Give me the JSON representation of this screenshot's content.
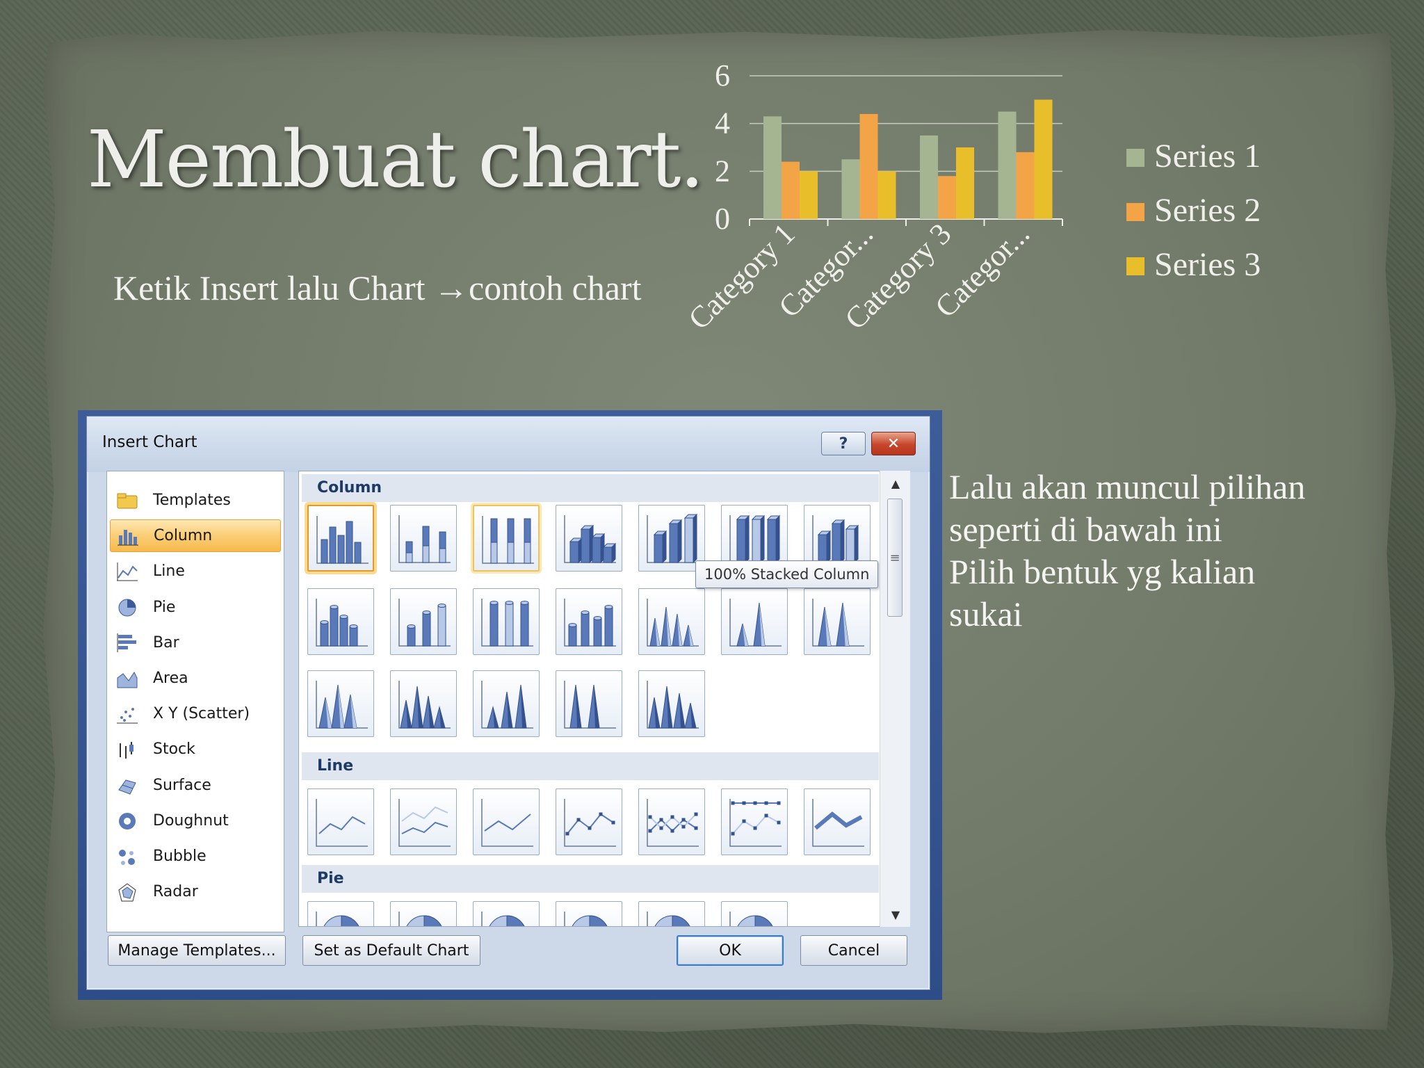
{
  "slide": {
    "title": "Membuat chart.",
    "subtitle": "Ketik Insert lalu Chart →contoh chart",
    "right_text": [
      "Lalu akan muncul pilihan",
      "seperti di bawah ini",
      "Pilih bentuk yg kalian",
      "sukai"
    ]
  },
  "chart_data": {
    "type": "bar",
    "categories": [
      "Category 1",
      "Categor...",
      "Category 3",
      "Categor..."
    ],
    "series": [
      {
        "name": "Series 1",
        "values": [
          4.3,
          2.5,
          3.5,
          4.5
        ],
        "color": "#a5b592"
      },
      {
        "name": "Series 2",
        "values": [
          2.4,
          4.4,
          1.8,
          2.8
        ],
        "color": "#f3a447"
      },
      {
        "name": "Series 3",
        "values": [
          2.0,
          2.0,
          3.0,
          5.0
        ],
        "color": "#e8bf2a"
      }
    ],
    "ylim": [
      0,
      6
    ],
    "yticks": [
      "0",
      "2",
      "4",
      "6"
    ],
    "grid": true,
    "legend": "right"
  },
  "dialog": {
    "title": "Insert Chart",
    "help_label": "?",
    "close_label": "✕",
    "chart_types": [
      {
        "label": "Templates",
        "icon": "folder-icon"
      },
      {
        "label": "Column",
        "icon": "column-chart-icon",
        "selected": true
      },
      {
        "label": "Line",
        "icon": "line-chart-icon"
      },
      {
        "label": "Pie",
        "icon": "pie-chart-icon"
      },
      {
        "label": "Bar",
        "icon": "bar-chart-icon"
      },
      {
        "label": "Area",
        "icon": "area-chart-icon"
      },
      {
        "label": "X Y (Scatter)",
        "icon": "scatter-chart-icon"
      },
      {
        "label": "Stock",
        "icon": "stock-chart-icon"
      },
      {
        "label": "Surface",
        "icon": "surface-chart-icon"
      },
      {
        "label": "Doughnut",
        "icon": "doughnut-chart-icon"
      },
      {
        "label": "Bubble",
        "icon": "bubble-chart-icon"
      },
      {
        "label": "Radar",
        "icon": "radar-chart-icon"
      }
    ],
    "sections": {
      "column": "Column",
      "line": "Line",
      "pie": "Pie"
    },
    "tooltip": "100% Stacked Column",
    "buttons": {
      "manage_templates": "Manage Templates...",
      "set_default": "Set as Default Chart",
      "ok": "OK",
      "cancel": "Cancel"
    },
    "colors": {
      "selection_orange": "#f7b94d",
      "header_blue": "#1e3a66",
      "thumb_blue": "#5a79b8"
    }
  }
}
